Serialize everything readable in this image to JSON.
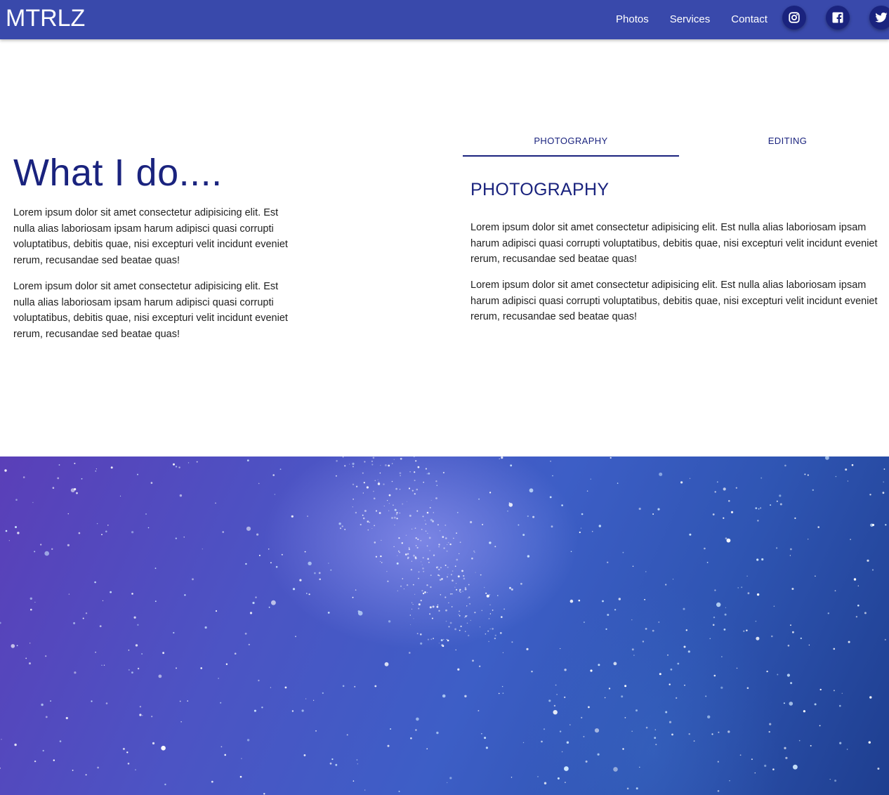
{
  "navbar": {
    "brand": "MTRLZ",
    "links": [
      "Photos",
      "Services",
      "Contact"
    ],
    "social": [
      "instagram-icon",
      "facebook-icon",
      "twitter-icon"
    ],
    "background_color": "#3949ab",
    "social_button_color": "#1a237e"
  },
  "intro": {
    "title": "What I do....",
    "paragraphs": [
      "Lorem ipsum dolor sit amet consectetur adipisicing elit. Est nulla alias laboriosam ipsam harum adipisci quasi corrupti voluptatibus, debitis quae, nisi excepturi velit incidunt eveniet rerum, recusandae sed beatae quas!",
      "Lorem ipsum dolor sit amet consectetur adipisicing elit. Est nulla alias laboriosam ipsam harum adipisci quasi corrupti voluptatibus, debitis quae, nisi excepturi velit incidunt eveniet rerum, recusandae sed beatae quas!"
    ]
  },
  "tabs": {
    "items": [
      "PHOTOGRAPHY",
      "EDITING"
    ],
    "active": "PHOTOGRAPHY"
  },
  "panel": {
    "title": "PHOTOGRAPHY",
    "paragraphs": [
      "Lorem ipsum dolor sit amet consectetur adipisicing elit. Est nulla alias laboriosam ipsam harum adipisci quasi corrupti voluptatibus, debitis quae, nisi excepturi velit incidunt eveniet rerum, recusandae sed beatae quas!",
      "Lorem ipsum dolor sit amet consectetur adipisicing elit. Est nulla alias laboriosam ipsam harum adipisci quasi corrupti voluptatibus, debitis quae, nisi excepturi velit incidunt eveniet rerum, recusandae sed beatae quas!"
    ]
  },
  "colors": {
    "accent": "#1a237e",
    "text": "#212121"
  }
}
